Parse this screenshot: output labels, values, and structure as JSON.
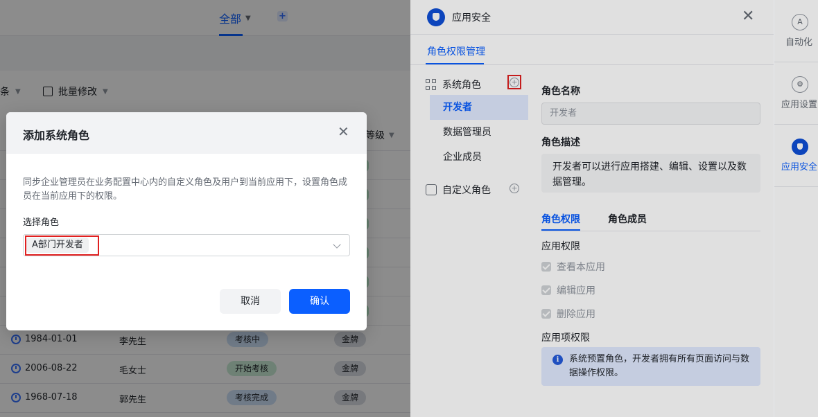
{
  "background": {
    "tab_all_label": "全部",
    "toolbar_left_label": "条",
    "batch_edit_label": "批量修改",
    "level_header": "等级",
    "rows": [
      {
        "date": "1984-01-01",
        "name": "李先生",
        "status": "考核中",
        "level": "金牌"
      },
      {
        "date": "2006-08-22",
        "name": "毛女士",
        "status": "开始考核",
        "level": "金牌"
      },
      {
        "date": "1968-07-18",
        "name": "郭先生",
        "status": "考核完成",
        "level": "金牌"
      }
    ]
  },
  "panel": {
    "title": "应用安全",
    "tab_label": "角色权限管理",
    "system_roles_label": "系统角色",
    "custom_roles_label": "自定义角色",
    "role_items": [
      "开发者",
      "数据管理员",
      "企业成员"
    ],
    "role_name_label": "角色名称",
    "role_name_value": "开发者",
    "role_desc_label": "角色描述",
    "role_desc_value": "开发者可以进行应用搭建、编辑、设置以及数据管理。",
    "tab_permissions": "角色权限",
    "tab_members": "角色成员",
    "app_permissions_label": "应用权限",
    "permissions": [
      "查看本应用",
      "编辑应用",
      "删除应用"
    ],
    "item_permissions_label": "应用项权限",
    "info_text": "系统预置角色，开发者拥有所有页面访问与数据操作权限。"
  },
  "rail": {
    "items": [
      {
        "label": "自动化",
        "icon": "automation-icon"
      },
      {
        "label": "应用设置",
        "icon": "settings-icon"
      },
      {
        "label": "应用安全",
        "icon": "shield-icon"
      }
    ]
  },
  "modal": {
    "title": "添加系统角色",
    "description": "同步企业管理员在业务配置中心内的自定义角色及用户到当前应用下，设置角色成员在当前应用下的权限。",
    "select_label": "选择角色",
    "selected_role": "A部门开发者",
    "cancel_label": "取消",
    "confirm_label": "确认"
  },
  "colors": {
    "primary": "#0b5fff",
    "highlight_border": "#e02020"
  }
}
